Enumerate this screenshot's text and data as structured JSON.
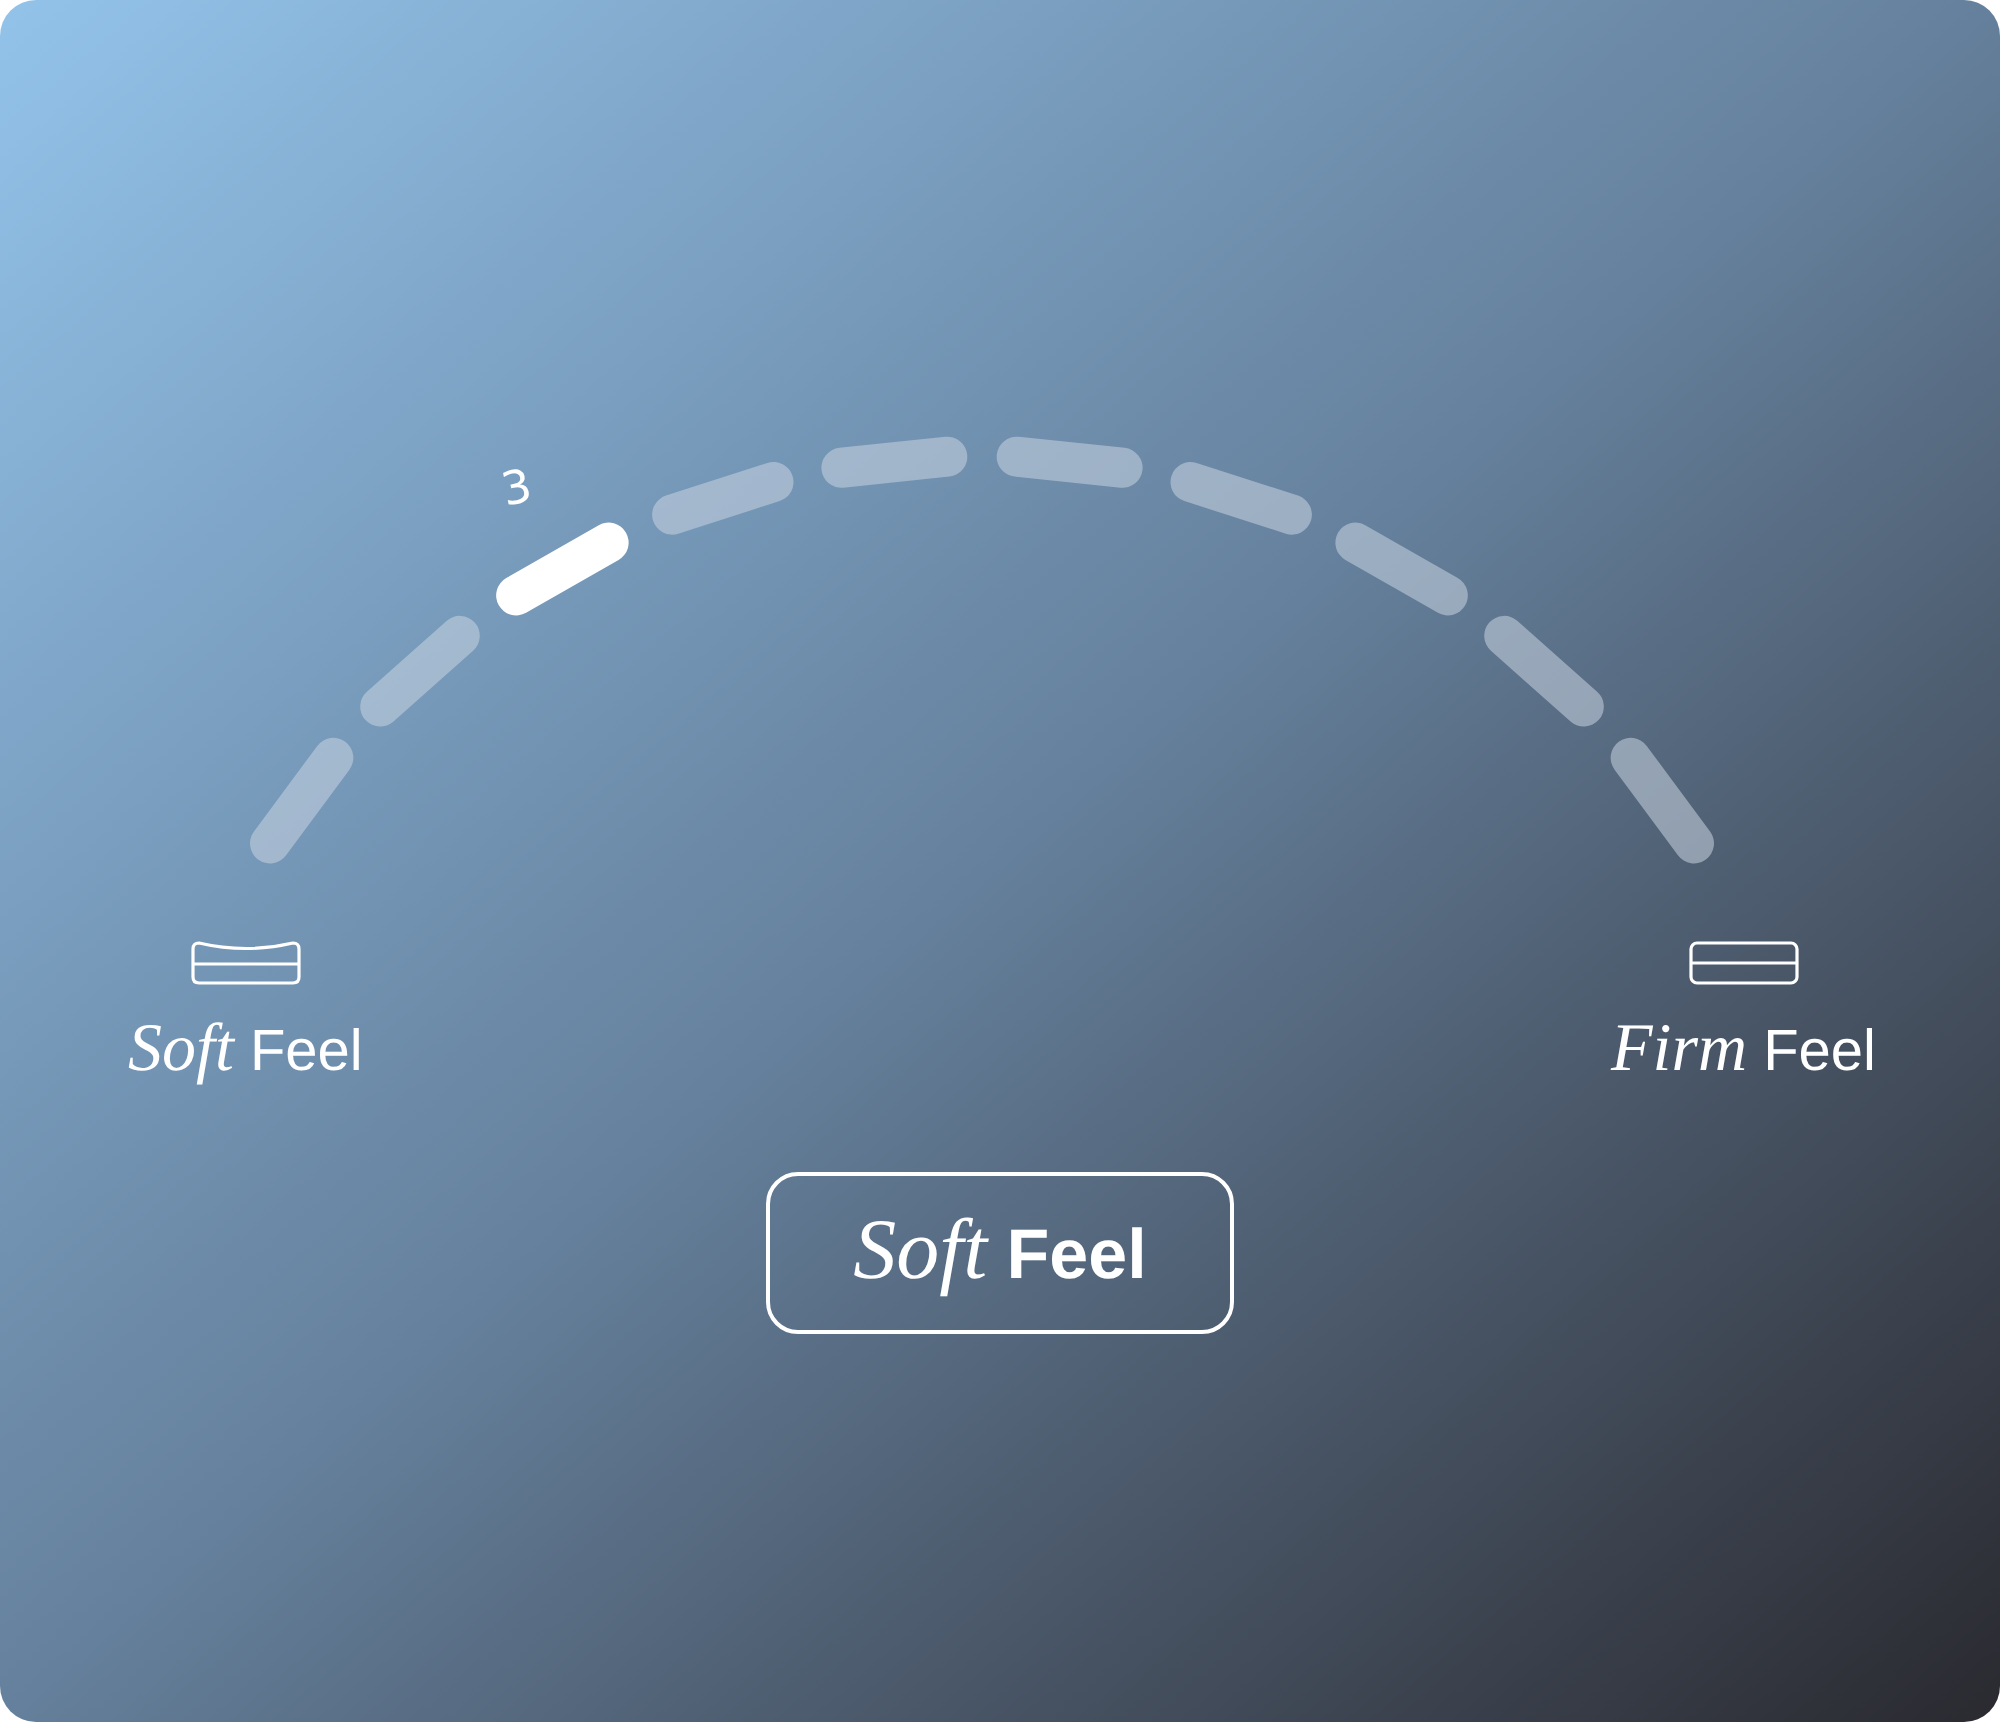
{
  "dial": {
    "label": "3",
    "segments": [
      {
        "selected": false
      },
      {
        "selected": false
      },
      {
        "selected": true
      },
      {
        "selected": false
      },
      {
        "selected": false
      },
      {
        "selected": false
      },
      {
        "selected": false
      },
      {
        "selected": false
      },
      {
        "selected": false
      },
      {
        "selected": false
      }
    ]
  },
  "ends": [
    {
      "kind": "soft",
      "label": "*Soft* Feel"
    },
    {
      "kind": "firm",
      "label": "*Firm* Feel"
    }
  ],
  "button": {
    "label": "*Soft* Feel"
  }
}
